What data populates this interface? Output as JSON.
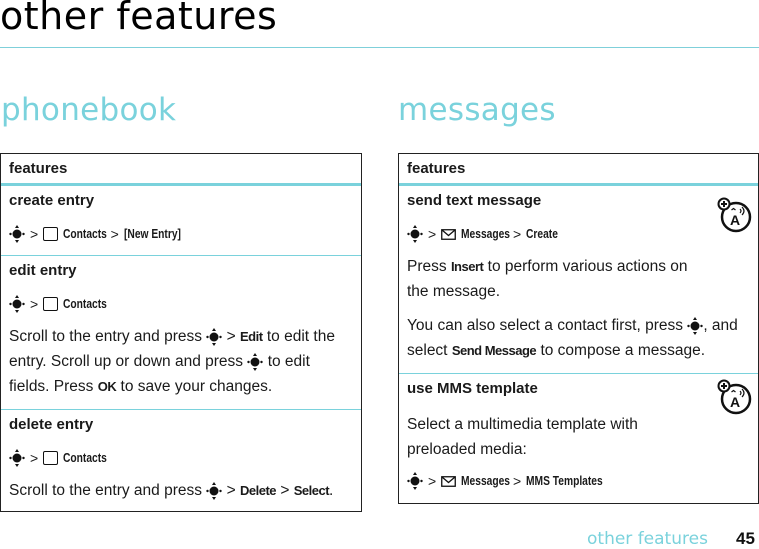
{
  "page": {
    "title": "other features",
    "footer_label": "other features",
    "page_number": "45"
  },
  "colors": {
    "accent": "#7ad2dc",
    "text": "#1a1a1a",
    "border": "#222222"
  },
  "phonebook": {
    "section_title": "phonebook",
    "header": "features",
    "rows": [
      {
        "title": "create entry",
        "path": [
          "Contacts",
          "[New Entry]"
        ]
      },
      {
        "title": "edit entry",
        "path": [
          "Contacts"
        ],
        "text": {
          "p1": "Scroll to the entry and press",
          "k1": "Edit",
          "p2": "to edit the entry. Scroll up or down and press",
          "p3": "to edit fields. Press",
          "k2": "OK",
          "p4": "to save your changes."
        }
      },
      {
        "title": "delete entry",
        "path": [
          "Contacts"
        ],
        "text": {
          "p1": "Scroll to the entry and press",
          "k1": "Delete",
          "k2": "Select",
          "end": "."
        }
      }
    ]
  },
  "messages": {
    "section_title": "messages",
    "header": "features",
    "rows": [
      {
        "title": "send text message",
        "icon": "network-feature-icon",
        "path": [
          "Messages",
          "Create"
        ],
        "text": {
          "p1": "Press",
          "k1": "Insert",
          "p2": "to perform various actions on the message.",
          "p3": "You can also select a contact first, press",
          "p4": ", and select",
          "k2": "Send Message",
          "p5": "to compose a message."
        }
      },
      {
        "title": "use MMS template",
        "icon": "network-feature-icon",
        "text": {
          "p1": "Select a multimedia template with preloaded media:"
        },
        "path": [
          "Messages",
          "MMS Templates"
        ]
      }
    ]
  },
  "symbols": {
    "separator": ">"
  }
}
